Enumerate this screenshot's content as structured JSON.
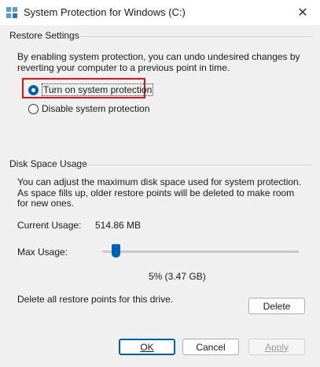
{
  "window": {
    "title": "System Protection for Windows (C:)",
    "close_glyph": "✕"
  },
  "restore": {
    "group_title": "Restore Settings",
    "description": "By enabling system protection, you can undo undesired changes by reverting your computer to a previous point in time.",
    "option_on": "Turn on system protection",
    "option_off": "Disable system protection",
    "selected": "on"
  },
  "disk": {
    "group_title": "Disk Space Usage",
    "description": "You can adjust the maximum disk space used for system protection. As space fills up, older restore points will be deleted to make room for new ones.",
    "current_label": "Current Usage:",
    "current_value": "514.86 MB",
    "max_label": "Max Usage:",
    "max_value": "5% (3.47 GB)",
    "max_fraction": 0.05,
    "delete_text": "Delete all restore points for this drive.",
    "delete_button": "Delete"
  },
  "footer": {
    "ok": "OK",
    "cancel": "Cancel",
    "apply": "Apply"
  },
  "colors": {
    "accent": "#005fb8",
    "highlight": "#e0121b"
  }
}
